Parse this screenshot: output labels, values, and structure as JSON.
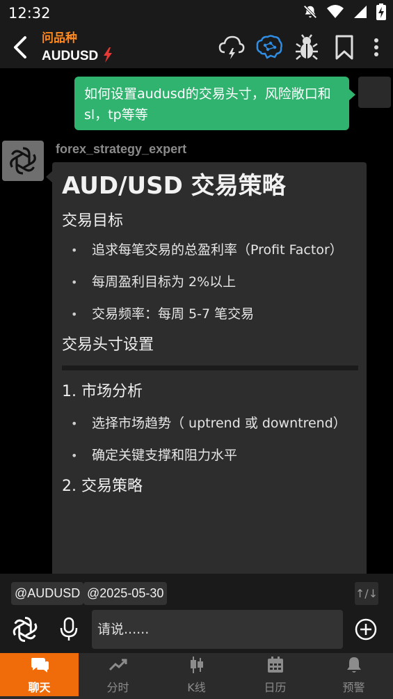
{
  "status_bar": {
    "time": "12:32"
  },
  "header": {
    "subtitle": "问品种",
    "title": "AUDUSD"
  },
  "chat": {
    "user_message": "如何设置audusd的交易头寸，风险敞口和sl，tp等等",
    "bot_name": "forex_strategy_expert",
    "bot_message": {
      "title": "AUD/USD 交易策略",
      "section1_heading": "交易目标",
      "section1_bullets": [
        "追求每笔交易的总盈利率（Profit Factor）",
        "每周盈利目标为 2%以上",
        "交易频率：每周 5-7 笔交易"
      ],
      "section2_heading": "交易头寸设置",
      "step1_heading": "1. 市场分析",
      "step1_bullets": [
        "选择市场趋势（ uptrend 或 downtrend）",
        "确定关键支撑和阻力水平"
      ],
      "step2_heading": "2. 交易策略"
    }
  },
  "tags": [
    "@AUDUSD",
    "@2025-05-30"
  ],
  "scroll_toggle_label": "↑/↓",
  "input": {
    "placeholder": "请说......"
  },
  "nav": {
    "items": [
      {
        "label": "聊天",
        "icon": "chat-bubbles-icon",
        "active": true
      },
      {
        "label": "分时",
        "icon": "trend-line-icon",
        "active": false
      },
      {
        "label": "K线",
        "icon": "candlestick-icon",
        "active": false
      },
      {
        "label": "日历",
        "icon": "calendar-icon",
        "active": false
      },
      {
        "label": "预警",
        "icon": "bell-icon",
        "active": false
      }
    ]
  },
  "colors": {
    "accent_orange": "#f06b0a",
    "user_bubble": "#2fb36f",
    "header_subtitle": "#ff8a1e",
    "brain_icon": "#2f8de4",
    "lightning": "#e53935"
  }
}
